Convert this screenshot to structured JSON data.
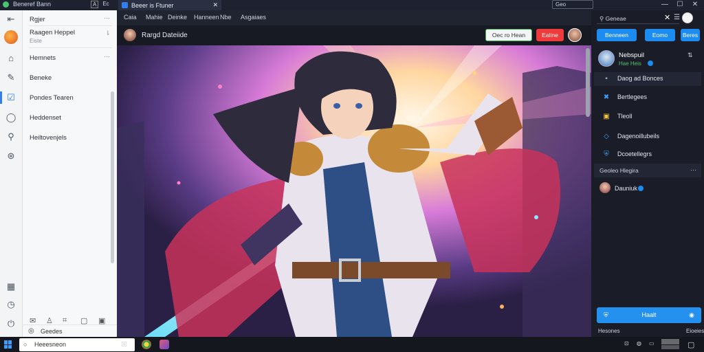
{
  "titlebar": {
    "app_name": "Beneref Bann",
    "tab_title": "Beeer is Ftuner",
    "mini_icons": [
      "A",
      "Ec"
    ],
    "search_text": "Geo",
    "controls": [
      "—",
      "☐",
      "✕"
    ]
  },
  "leftpanel": {
    "items": [
      {
        "label": "Rgjer",
        "sub": ""
      },
      {
        "label": "Raagen Heppel",
        "sub": "Eiste"
      },
      {
        "label": "Hemnets",
        "sub": ""
      },
      {
        "label": "Beneke",
        "sub": ""
      },
      {
        "label": "Pondes Tearen",
        "sub": ""
      },
      {
        "label": "Heddenset",
        "sub": ""
      },
      {
        "label": "Heiltovenjels",
        "sub": ""
      }
    ],
    "bottom_label": "Geedes"
  },
  "mainheader": {
    "menu": [
      "Caia",
      "Mahie",
      "Deinke",
      "Hanneen",
      "Nbe",
      "Asgaiaes"
    ]
  },
  "subheader": {
    "title": "Rargd Dateiide",
    "follow_label": "Oec ro Hean",
    "red_label": "Ealine"
  },
  "rightpanel": {
    "search_text": "Geneae",
    "btn1": "Benneen",
    "btn2": "Eomo",
    "btn3": "Beres",
    "profile_name": "Nebspuil",
    "profile_sub": "Hae Heis",
    "rows": [
      "Daog ad Bonces",
      "Bertlegees",
      "Tleoll",
      "Dagenoillubeils",
      "Dcoetellegrs"
    ],
    "section": "Geoleo Hlegira",
    "follower": "Dauniuk",
    "big_button": "Haalt",
    "footer_left": "Hesones",
    "footer_right": "Eioeies"
  },
  "taskbar": {
    "search": "Heeesneon"
  }
}
